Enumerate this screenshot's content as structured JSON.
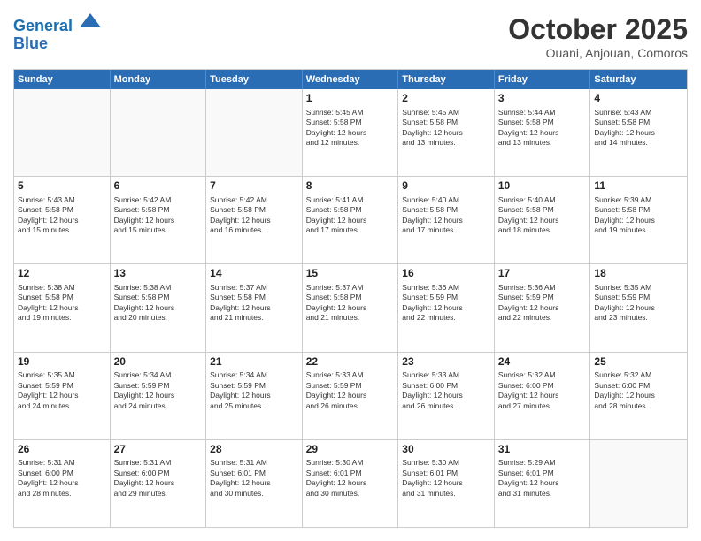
{
  "header": {
    "logo_line1": "General",
    "logo_line2": "Blue",
    "month": "October 2025",
    "location": "Ouani, Anjouan, Comoros"
  },
  "weekdays": [
    "Sunday",
    "Monday",
    "Tuesday",
    "Wednesday",
    "Thursday",
    "Friday",
    "Saturday"
  ],
  "rows": [
    [
      {
        "day": "",
        "text": ""
      },
      {
        "day": "",
        "text": ""
      },
      {
        "day": "",
        "text": ""
      },
      {
        "day": "1",
        "text": "Sunrise: 5:45 AM\nSunset: 5:58 PM\nDaylight: 12 hours\nand 12 minutes."
      },
      {
        "day": "2",
        "text": "Sunrise: 5:45 AM\nSunset: 5:58 PM\nDaylight: 12 hours\nand 13 minutes."
      },
      {
        "day": "3",
        "text": "Sunrise: 5:44 AM\nSunset: 5:58 PM\nDaylight: 12 hours\nand 13 minutes."
      },
      {
        "day": "4",
        "text": "Sunrise: 5:43 AM\nSunset: 5:58 PM\nDaylight: 12 hours\nand 14 minutes."
      }
    ],
    [
      {
        "day": "5",
        "text": "Sunrise: 5:43 AM\nSunset: 5:58 PM\nDaylight: 12 hours\nand 15 minutes."
      },
      {
        "day": "6",
        "text": "Sunrise: 5:42 AM\nSunset: 5:58 PM\nDaylight: 12 hours\nand 15 minutes."
      },
      {
        "day": "7",
        "text": "Sunrise: 5:42 AM\nSunset: 5:58 PM\nDaylight: 12 hours\nand 16 minutes."
      },
      {
        "day": "8",
        "text": "Sunrise: 5:41 AM\nSunset: 5:58 PM\nDaylight: 12 hours\nand 17 minutes."
      },
      {
        "day": "9",
        "text": "Sunrise: 5:40 AM\nSunset: 5:58 PM\nDaylight: 12 hours\nand 17 minutes."
      },
      {
        "day": "10",
        "text": "Sunrise: 5:40 AM\nSunset: 5:58 PM\nDaylight: 12 hours\nand 18 minutes."
      },
      {
        "day": "11",
        "text": "Sunrise: 5:39 AM\nSunset: 5:58 PM\nDaylight: 12 hours\nand 19 minutes."
      }
    ],
    [
      {
        "day": "12",
        "text": "Sunrise: 5:38 AM\nSunset: 5:58 PM\nDaylight: 12 hours\nand 19 minutes."
      },
      {
        "day": "13",
        "text": "Sunrise: 5:38 AM\nSunset: 5:58 PM\nDaylight: 12 hours\nand 20 minutes."
      },
      {
        "day": "14",
        "text": "Sunrise: 5:37 AM\nSunset: 5:58 PM\nDaylight: 12 hours\nand 21 minutes."
      },
      {
        "day": "15",
        "text": "Sunrise: 5:37 AM\nSunset: 5:58 PM\nDaylight: 12 hours\nand 21 minutes."
      },
      {
        "day": "16",
        "text": "Sunrise: 5:36 AM\nSunset: 5:59 PM\nDaylight: 12 hours\nand 22 minutes."
      },
      {
        "day": "17",
        "text": "Sunrise: 5:36 AM\nSunset: 5:59 PM\nDaylight: 12 hours\nand 22 minutes."
      },
      {
        "day": "18",
        "text": "Sunrise: 5:35 AM\nSunset: 5:59 PM\nDaylight: 12 hours\nand 23 minutes."
      }
    ],
    [
      {
        "day": "19",
        "text": "Sunrise: 5:35 AM\nSunset: 5:59 PM\nDaylight: 12 hours\nand 24 minutes."
      },
      {
        "day": "20",
        "text": "Sunrise: 5:34 AM\nSunset: 5:59 PM\nDaylight: 12 hours\nand 24 minutes."
      },
      {
        "day": "21",
        "text": "Sunrise: 5:34 AM\nSunset: 5:59 PM\nDaylight: 12 hours\nand 25 minutes."
      },
      {
        "day": "22",
        "text": "Sunrise: 5:33 AM\nSunset: 5:59 PM\nDaylight: 12 hours\nand 26 minutes."
      },
      {
        "day": "23",
        "text": "Sunrise: 5:33 AM\nSunset: 6:00 PM\nDaylight: 12 hours\nand 26 minutes."
      },
      {
        "day": "24",
        "text": "Sunrise: 5:32 AM\nSunset: 6:00 PM\nDaylight: 12 hours\nand 27 minutes."
      },
      {
        "day": "25",
        "text": "Sunrise: 5:32 AM\nSunset: 6:00 PM\nDaylight: 12 hours\nand 28 minutes."
      }
    ],
    [
      {
        "day": "26",
        "text": "Sunrise: 5:31 AM\nSunset: 6:00 PM\nDaylight: 12 hours\nand 28 minutes."
      },
      {
        "day": "27",
        "text": "Sunrise: 5:31 AM\nSunset: 6:00 PM\nDaylight: 12 hours\nand 29 minutes."
      },
      {
        "day": "28",
        "text": "Sunrise: 5:31 AM\nSunset: 6:01 PM\nDaylight: 12 hours\nand 30 minutes."
      },
      {
        "day": "29",
        "text": "Sunrise: 5:30 AM\nSunset: 6:01 PM\nDaylight: 12 hours\nand 30 minutes."
      },
      {
        "day": "30",
        "text": "Sunrise: 5:30 AM\nSunset: 6:01 PM\nDaylight: 12 hours\nand 31 minutes."
      },
      {
        "day": "31",
        "text": "Sunrise: 5:29 AM\nSunset: 6:01 PM\nDaylight: 12 hours\nand 31 minutes."
      },
      {
        "day": "",
        "text": ""
      }
    ]
  ]
}
